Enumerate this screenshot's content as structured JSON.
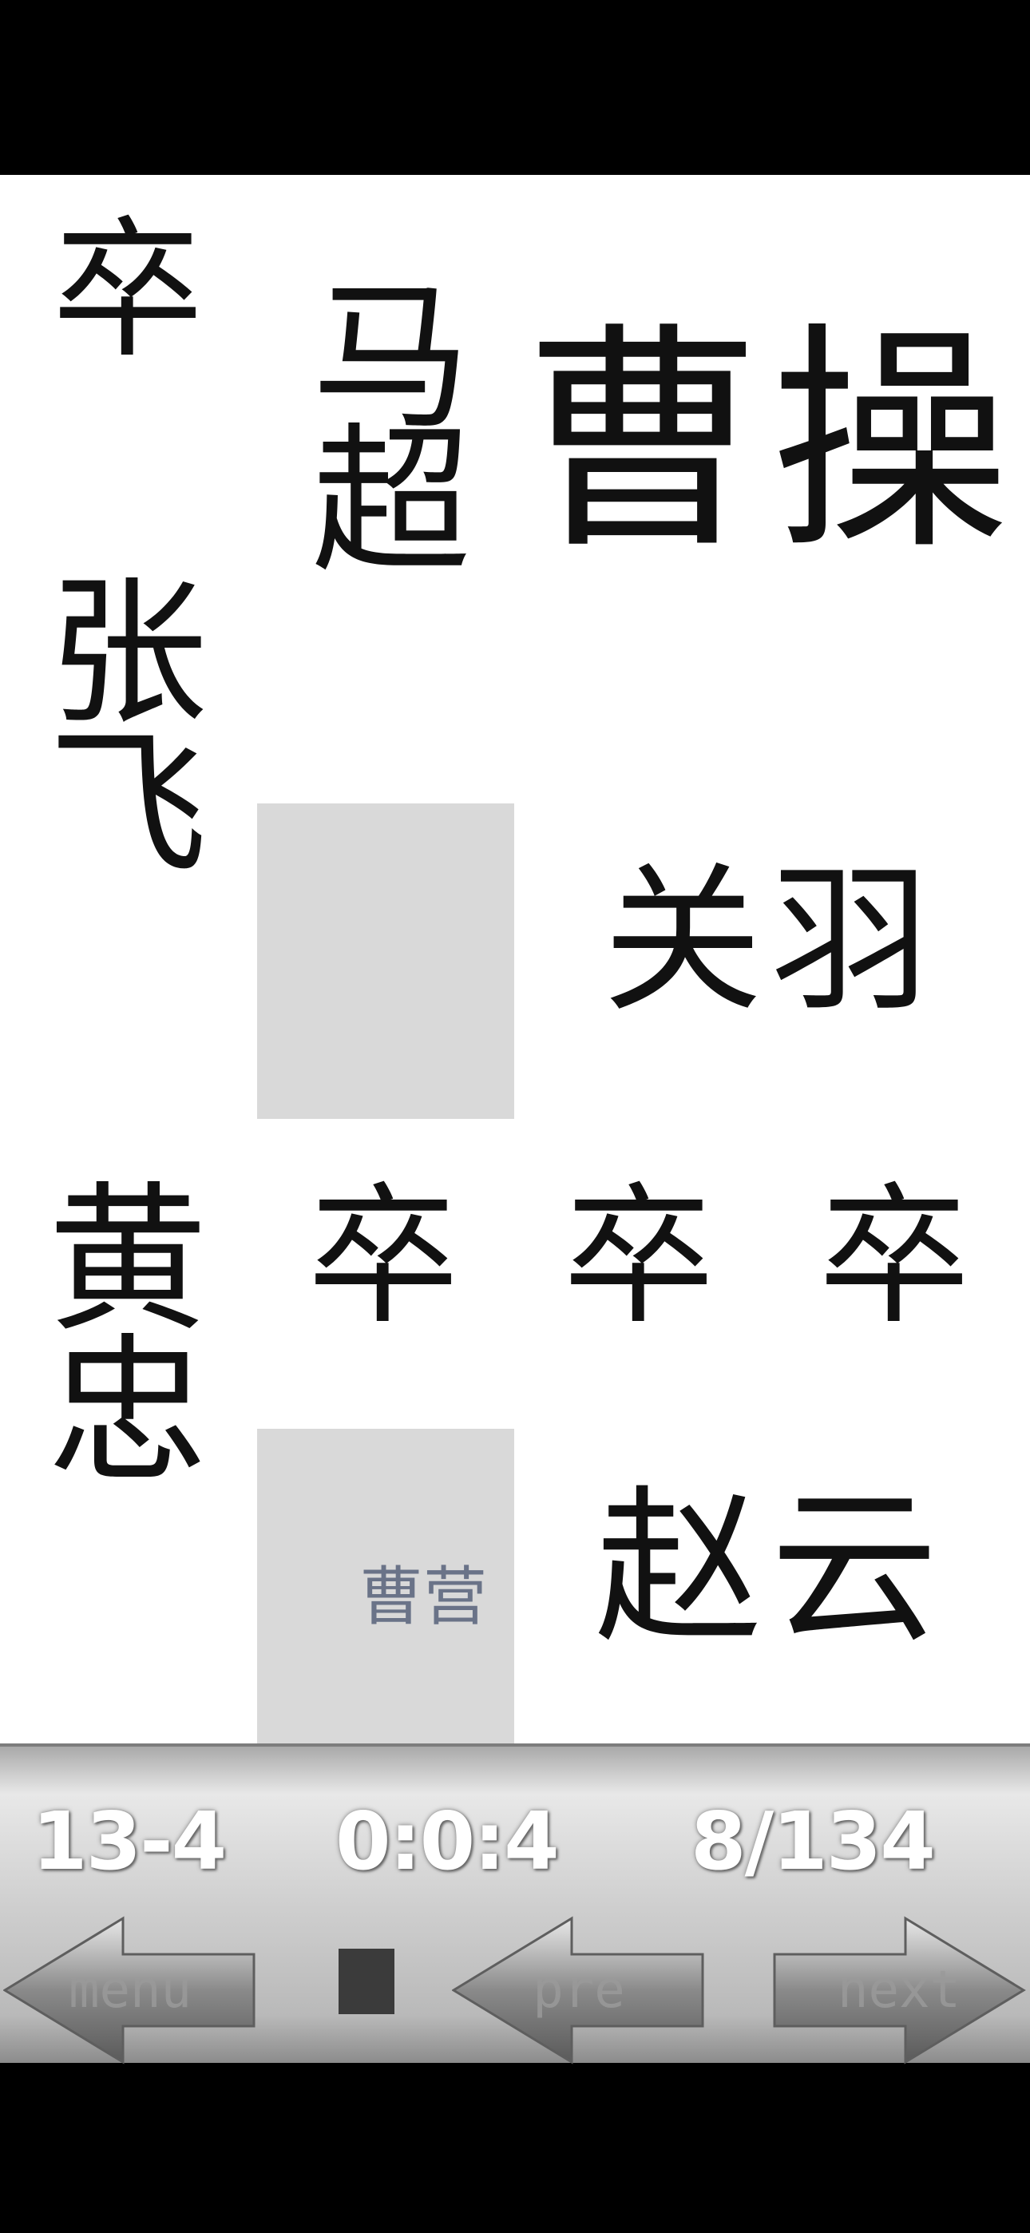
{
  "pieces": {
    "zu_top_left": "卒",
    "ma_chao": [
      "马",
      "超"
    ],
    "cao_cao": [
      "曹",
      "操"
    ],
    "zhang_fei": [
      "张",
      "飞"
    ],
    "guan_yu": [
      "关",
      "羽"
    ],
    "huang_zhong": [
      "黄",
      "忠"
    ],
    "zu_center": "卒",
    "zu_right_1": "卒",
    "zu_right_2": "卒",
    "zhao_yun": [
      "赵",
      "云"
    ]
  },
  "exit_label": "曹营",
  "status": {
    "level": "13-4",
    "timer": "0:0:4",
    "progress": "8/134"
  },
  "controls": {
    "menu_label": "menu",
    "prev_label": "pre",
    "next_label": "next"
  }
}
